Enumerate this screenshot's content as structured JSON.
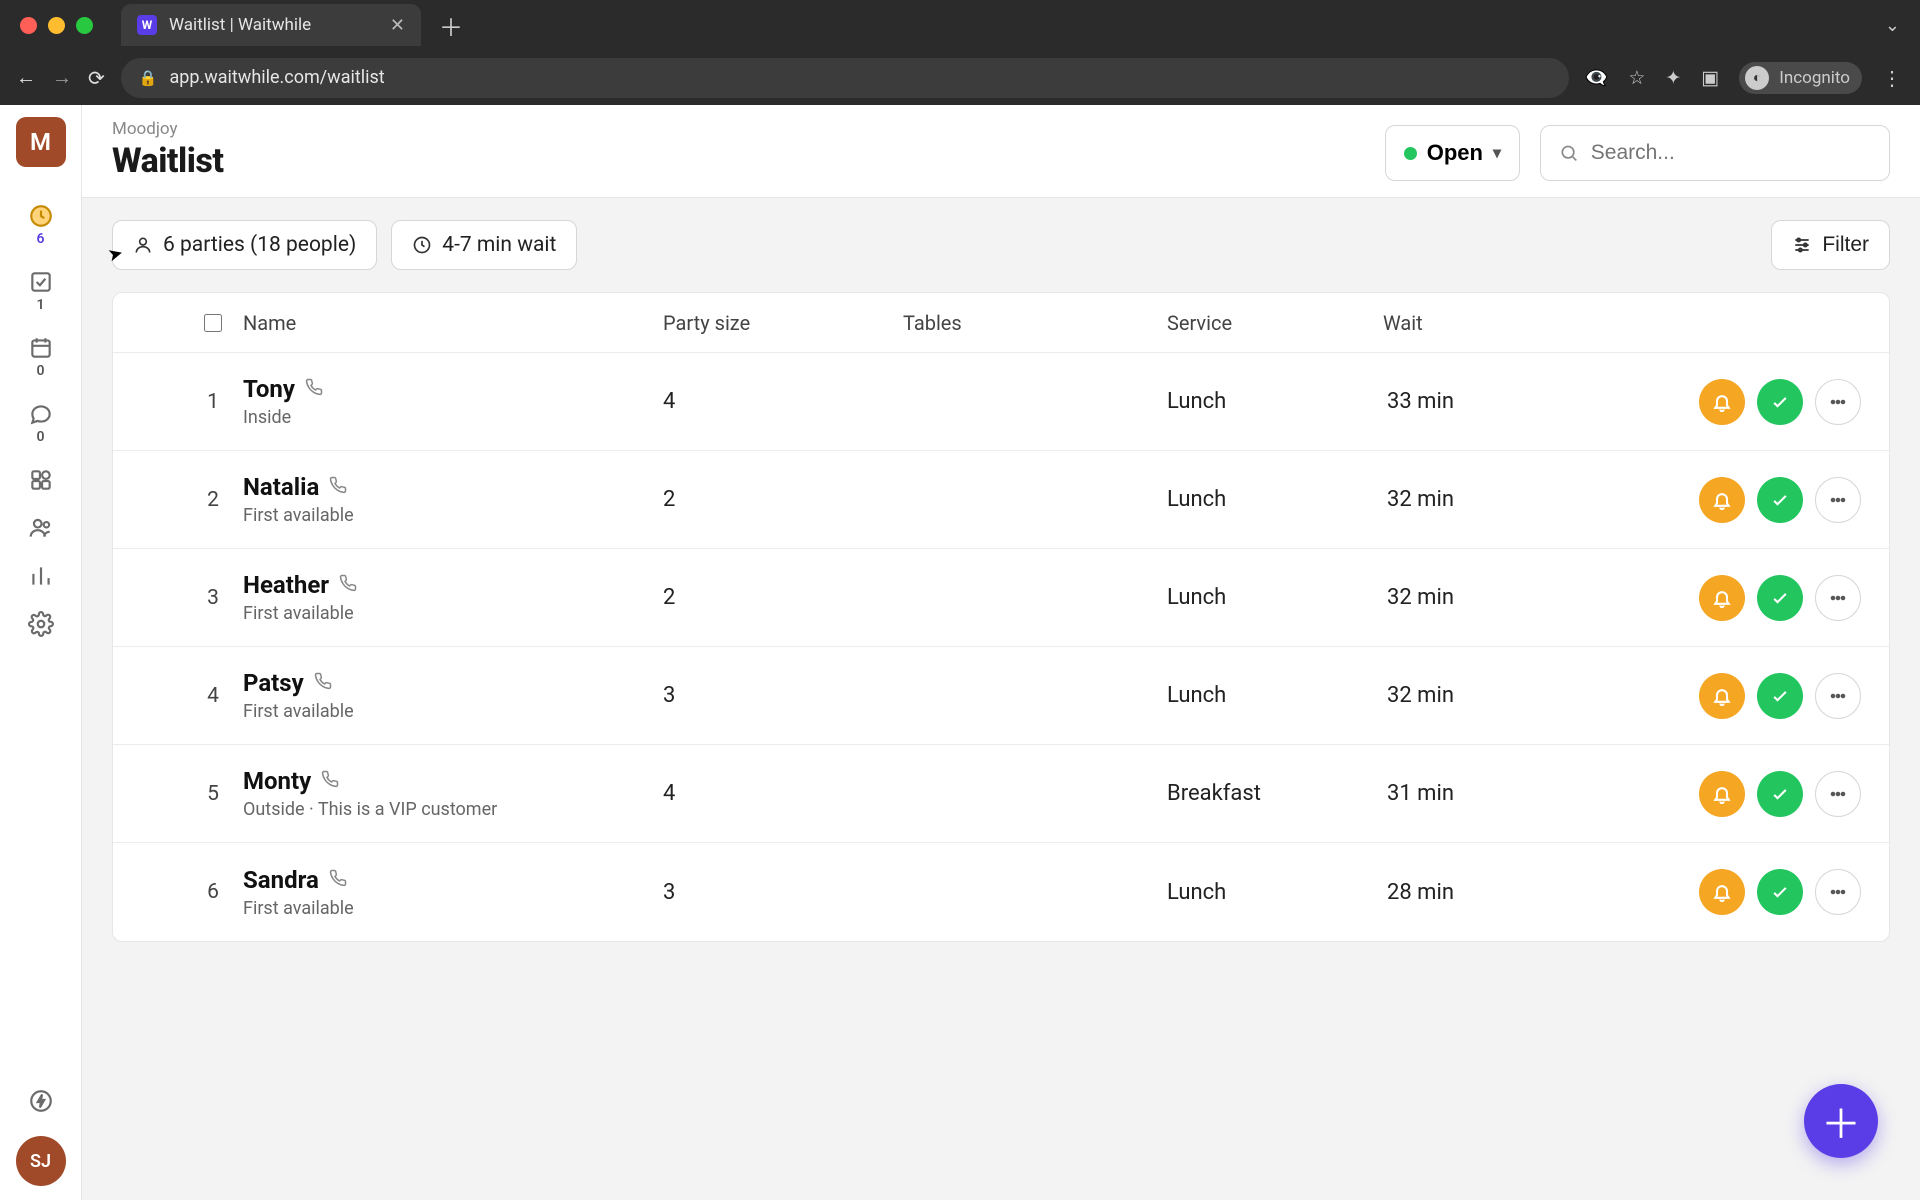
{
  "browser": {
    "tab_title": "Waitlist | Waitwhile",
    "url": "app.waitwhile.com/waitlist",
    "incognito_label": "Incognito"
  },
  "sidebar": {
    "logo_letter": "M",
    "items": [
      {
        "count": "6"
      },
      {
        "count": "1"
      },
      {
        "count": "0"
      },
      {
        "count": "0"
      }
    ],
    "user_initials": "SJ"
  },
  "header": {
    "breadcrumb": "Moodjoy",
    "title": "Waitlist",
    "status_label": "Open",
    "search_placeholder": "Search..."
  },
  "toolbar": {
    "parties_label": "6 parties (18 people)",
    "wait_label": "4-7 min wait",
    "filter_label": "Filter"
  },
  "columns": {
    "name": "Name",
    "party": "Party size",
    "tables": "Tables",
    "service": "Service",
    "wait": "Wait"
  },
  "rows": [
    {
      "idx": "1",
      "name": "Tony",
      "sub": "Inside",
      "party": "4",
      "tables": "",
      "service": "Lunch",
      "wait": "33 min"
    },
    {
      "idx": "2",
      "name": "Natalia",
      "sub": "First available",
      "party": "2",
      "tables": "",
      "service": "Lunch",
      "wait": "32 min"
    },
    {
      "idx": "3",
      "name": "Heather",
      "sub": "First available",
      "party": "2",
      "tables": "",
      "service": "Lunch",
      "wait": "32 min"
    },
    {
      "idx": "4",
      "name": "Patsy",
      "sub": "First available",
      "party": "3",
      "tables": "",
      "service": "Lunch",
      "wait": "32 min"
    },
    {
      "idx": "5",
      "name": "Monty",
      "sub": "Outside  ·  This is a VIP customer",
      "party": "4",
      "tables": "",
      "service": "Breakfast",
      "wait": "31 min"
    },
    {
      "idx": "6",
      "name": "Sandra",
      "sub": "First available",
      "party": "3",
      "tables": "",
      "service": "Lunch",
      "wait": "28 min"
    }
  ]
}
